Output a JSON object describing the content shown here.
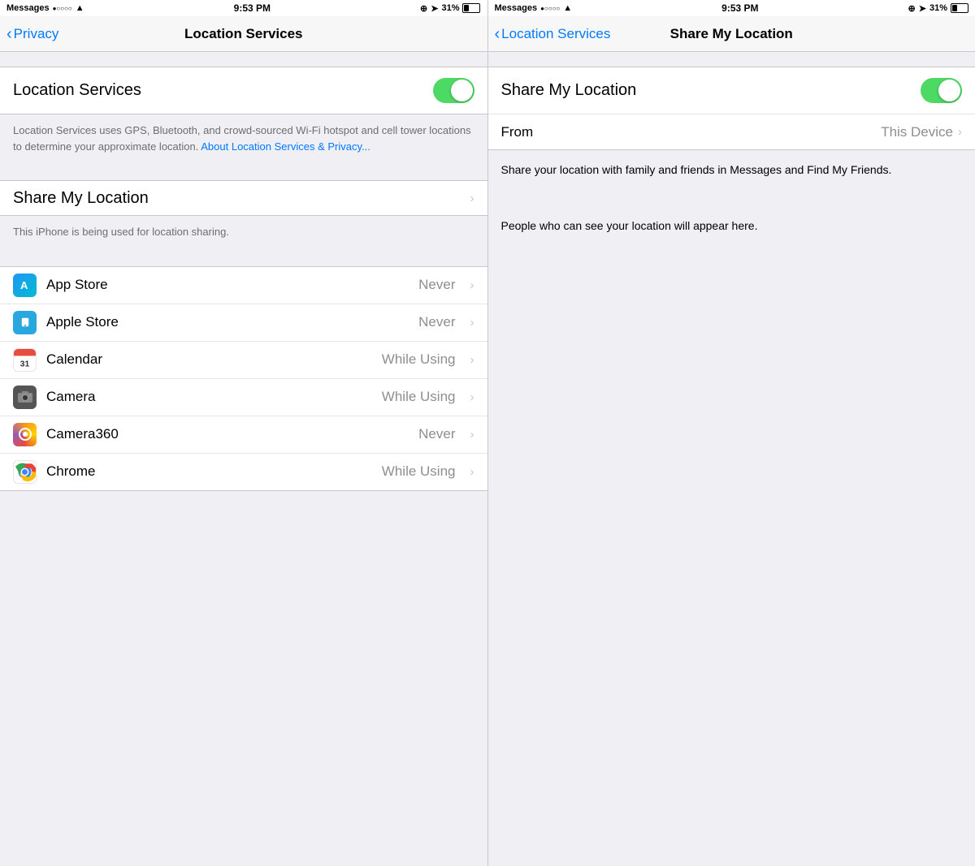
{
  "left": {
    "statusBar": {
      "carrier": "Messages",
      "dots": "●○○○○",
      "wifi": "wifi",
      "time": "9:53 PM",
      "location": "⊕ ➤",
      "battery": "31%"
    },
    "navBar": {
      "backLabel": "Privacy",
      "title": "Location Services"
    },
    "locationServices": {
      "label": "Location Services",
      "toggleOn": true,
      "description": "Location Services uses GPS, Bluetooth, and crowd-sourced Wi-Fi hotspot and cell tower locations to determine your approximate location.",
      "linkText": "About Location Services & Privacy..."
    },
    "shareMyLocation": {
      "label": "Share My Location",
      "subText": "This iPhone is being used for location sharing."
    },
    "apps": [
      {
        "name": "App Store",
        "permission": "Never",
        "iconType": "appstore"
      },
      {
        "name": "Apple Store",
        "permission": "Never",
        "iconType": "applestore"
      },
      {
        "name": "Calendar",
        "permission": "While Using",
        "iconType": "calendar"
      },
      {
        "name": "Camera",
        "permission": "While Using",
        "iconType": "camera"
      },
      {
        "name": "Camera360",
        "permission": "Never",
        "iconType": "camera360"
      },
      {
        "name": "Chrome",
        "permission": "While Using",
        "iconType": "chrome"
      }
    ]
  },
  "right": {
    "statusBar": {
      "carrier": "Messages",
      "dots": "●○○○○",
      "wifi": "wifi",
      "time": "9:53 PM",
      "location": "⊕ ➤",
      "battery": "31%"
    },
    "navBar": {
      "backLabel": "Location Services",
      "title": "Share My Location"
    },
    "shareMyLocation": {
      "label": "Share My Location",
      "toggleOn": true
    },
    "from": {
      "label": "From",
      "value": "This Device"
    },
    "description": "Share your location with family and friends in Messages and Find My Friends.",
    "peopleText": "People who can see your location will appear here."
  }
}
